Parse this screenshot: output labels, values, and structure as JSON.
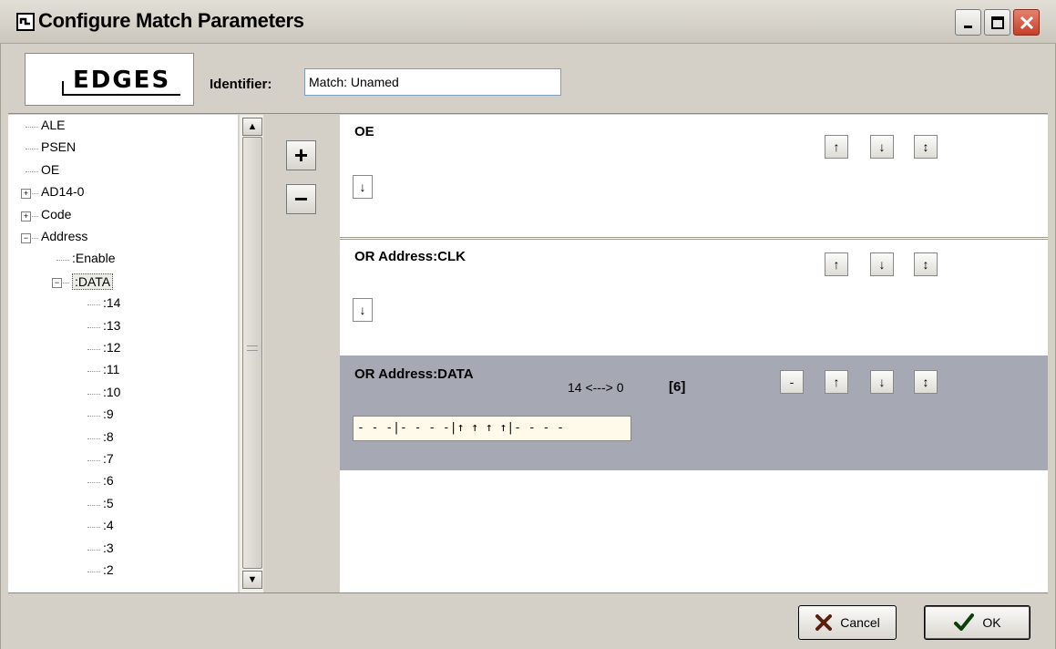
{
  "window": {
    "title": "Configure Match Parameters"
  },
  "header": {
    "logo_text": "EDGES",
    "identifier_label": "Identifier:",
    "identifier_value": "Match: Unamed"
  },
  "tree": {
    "items": [
      {
        "label": "ALE",
        "level": 0,
        "expander": ""
      },
      {
        "label": "PSEN",
        "level": 0,
        "expander": ""
      },
      {
        "label": "OE",
        "level": 0,
        "expander": ""
      },
      {
        "label": "AD14-0",
        "level": 0,
        "expander": "+"
      },
      {
        "label": "Code",
        "level": 0,
        "expander": "+"
      },
      {
        "label": "Address",
        "level": 0,
        "expander": "-"
      },
      {
        "label": ":Enable",
        "level": 1,
        "expander": ""
      },
      {
        "label": ":DATA",
        "level": 1,
        "expander": "-"
      },
      {
        "label": ":14",
        "level": 2,
        "expander": ""
      },
      {
        "label": ":13",
        "level": 2,
        "expander": ""
      },
      {
        "label": ":12",
        "level": 2,
        "expander": ""
      },
      {
        "label": ":11",
        "level": 2,
        "expander": ""
      },
      {
        "label": ":10",
        "level": 2,
        "expander": ""
      },
      {
        "label": ":9",
        "level": 2,
        "expander": ""
      },
      {
        "label": ":8",
        "level": 2,
        "expander": ""
      },
      {
        "label": ":7",
        "level": 2,
        "expander": ""
      },
      {
        "label": ":6",
        "level": 2,
        "expander": ""
      },
      {
        "label": ":5",
        "level": 2,
        "expander": ""
      },
      {
        "label": ":4",
        "level": 2,
        "expander": ""
      },
      {
        "label": ":3",
        "level": 2,
        "expander": ""
      },
      {
        "label": ":2",
        "level": 2,
        "expander": ""
      }
    ]
  },
  "buttons": {
    "add": "+",
    "remove": "−",
    "cancel": "Cancel",
    "ok": "OK"
  },
  "panels": {
    "oe": {
      "title": "OE",
      "edge": "↓"
    },
    "clk": {
      "title": "OR  Address:CLK",
      "edge": "↓"
    },
    "data": {
      "title": "OR  Address:DATA",
      "range": "14 <---> 0",
      "count": "[6]",
      "bits": "- - -|- - - -|↑ ↑ ↑ ↑|- - - -",
      "minus": "-"
    }
  },
  "edge_buttons": {
    "rising": "↑",
    "falling": "↓",
    "both": "↕"
  },
  "colors": {
    "selected_panel": "#a6a9b4",
    "bits_bg": "#fffaea",
    "cancel_x": "#5b1e0f",
    "ok_check": "#0a3f0a"
  }
}
